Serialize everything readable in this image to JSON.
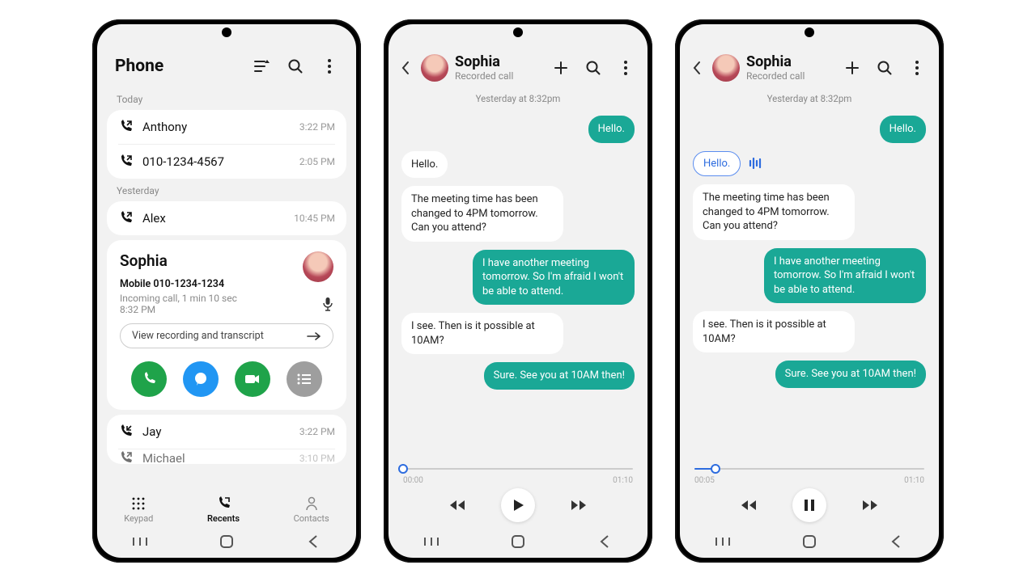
{
  "screen1": {
    "title": "Phone",
    "sections": {
      "today_label": "Today",
      "yesterday_label": "Yesterday"
    },
    "calls": {
      "today": [
        {
          "name": "Anthony",
          "time": "3:22 PM",
          "dir": "out"
        },
        {
          "name": "010-1234-4567",
          "time": "2:05 PM",
          "dir": "out"
        }
      ],
      "yesterday": [
        {
          "name": "Alex",
          "time": "10:45 PM",
          "dir": "out"
        }
      ],
      "after": [
        {
          "name": "Jay",
          "time": "3:22 PM",
          "dir": "in"
        },
        {
          "name": "Michael",
          "time": "3:10 PM",
          "dir": "out"
        }
      ]
    },
    "expanded": {
      "name": "Sophia",
      "detail": "Mobile 010-1234-1234",
      "meta": "Incoming call, 1 min 10 sec",
      "time": "8:32 PM",
      "view_label": "View recording and transcript"
    },
    "tabs": {
      "keypad": "Keypad",
      "recents": "Recents",
      "contacts": "Contacts"
    }
  },
  "transcript": {
    "name": "Sophia",
    "sub": "Recorded call",
    "timestamp": "Yesterday at 8:32pm",
    "messages": {
      "m1": "Hello.",
      "m2": "Hello.",
      "m3": "The meeting time has been changed to 4PM tomorrow. Can you attend?",
      "m4": "I have another meeting tomorrow. So I'm afraid I won't be able to attend.",
      "m5": "I see. Then is it possible at 10AM?",
      "m6": "Sure. See you at 10AM then!"
    },
    "player2": {
      "cur": "00:00",
      "dur": "01:10",
      "progress_pct": 0
    },
    "player3": {
      "cur": "00:05",
      "dur": "01:10",
      "progress_pct": 9
    }
  }
}
